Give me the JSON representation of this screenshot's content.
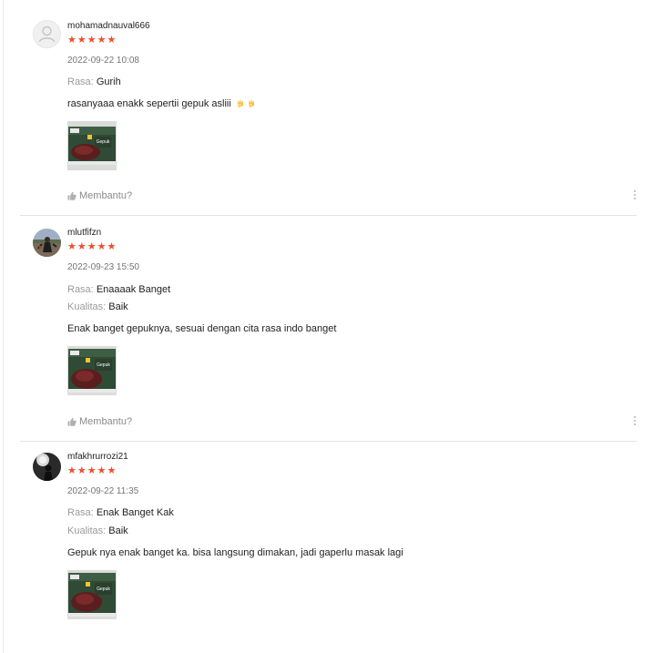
{
  "reviews": [
    {
      "username": "mohamadnauval666",
      "stars": "★★★★★",
      "date": "2022-09-22 10:08",
      "attributes": [
        {
          "key": "Rasa:",
          "value": "Gurih"
        }
      ],
      "comment": "rasanyaaa enakk sepertii gepuk asliii",
      "comment_emojis": [
        "ok-hand-emoji",
        "ok-hand-emoji"
      ],
      "helpful_label": "Membantu?"
    },
    {
      "username": "mlutfifzn",
      "stars": "★★★★★",
      "date": "2022-09-23 15:50",
      "attributes": [
        {
          "key": "Rasa:",
          "value": "Enaaaak Banget"
        },
        {
          "key": "Kualitas:",
          "value": "Baik"
        }
      ],
      "comment": "Enak banget gepuknya, sesuai dengan cita rasa indo banget",
      "helpful_label": "Membantu?"
    },
    {
      "username": "mfakhrurrozi21",
      "stars": "★★★★★",
      "date": "2022-09-22 11:35",
      "attributes": [
        {
          "key": "Rasa:",
          "value": "Enak Banget Kak"
        },
        {
          "key": "Kualitas:",
          "value": "Baik"
        }
      ],
      "comment": "Gepuk nya enak banget ka. bisa langsung dimakan, jadi gaperlu masak lagi"
    }
  ],
  "product_photo_text": "Gepuk",
  "icons": {
    "helpful": "thumbs-up-icon",
    "more": "more-vertical-icon",
    "avatar_default": "user-icon"
  },
  "colors": {
    "star": "#ee4d2d",
    "muted": "#757575",
    "divider": "#e3e3e3"
  }
}
